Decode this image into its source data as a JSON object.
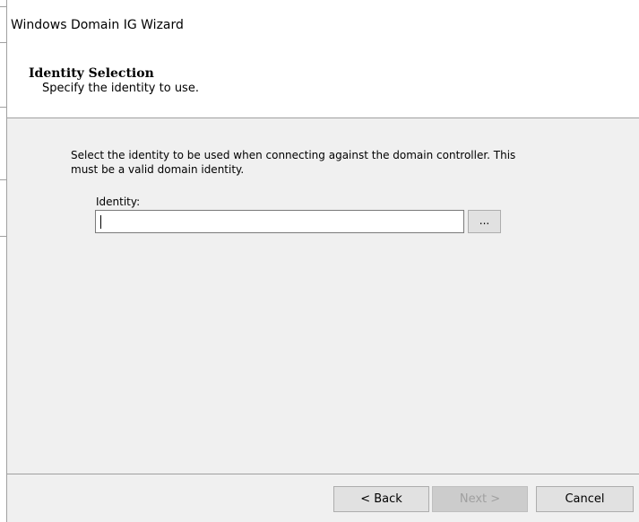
{
  "window": {
    "title": "Windows Domain IG Wizard"
  },
  "header": {
    "heading": "Identity Selection",
    "subheading": "Specify the identity to use."
  },
  "content": {
    "description_line1": "Select the identity to be used when connecting against the domain controller. This",
    "description_line2": "must be a valid domain identity.",
    "identity_label": "Identity:",
    "identity_value": "",
    "browse_label": "..."
  },
  "footer": {
    "back_label": "< Back",
    "next_label": "Next >",
    "cancel_label": "Cancel",
    "next_enabled": false
  }
}
